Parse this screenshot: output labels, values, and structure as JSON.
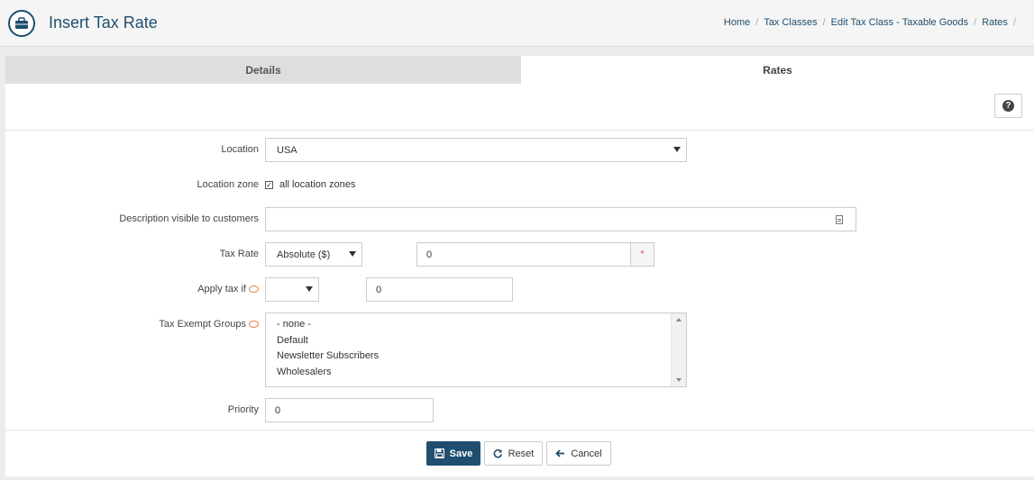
{
  "header": {
    "title": "Insert Tax Rate",
    "icon": "briefcase-icon",
    "breadcrumb": [
      "Home",
      "Tax Classes",
      "Edit Tax Class - Taxable Goods",
      "Rates"
    ]
  },
  "tabs": [
    {
      "label": "Details",
      "active": false
    },
    {
      "label": "Rates",
      "active": true
    }
  ],
  "form": {
    "location": {
      "label": "Location",
      "value": "USA"
    },
    "location_zone": {
      "label": "Location zone",
      "checkbox_label": "all location zones",
      "checked": true
    },
    "description": {
      "label": "Description visible to customers",
      "value": ""
    },
    "tax_rate": {
      "label": "Tax Rate",
      "type_value": "Absolute ($)",
      "amount": "0",
      "required_mark": "*"
    },
    "apply_tax_if": {
      "label": "Apply tax if",
      "condition": "",
      "value": "0"
    },
    "tax_exempt_groups": {
      "label": "Tax Exempt Groups",
      "options": [
        "- none -",
        "Default",
        "Newsletter Subscribers",
        "Wholesalers"
      ]
    },
    "priority": {
      "label": "Priority",
      "value": "0"
    }
  },
  "actions": {
    "save": "Save",
    "reset": "Reset",
    "cancel": "Cancel"
  },
  "colors": {
    "brand": "#1f4e6e",
    "accent_icon": "#e8843a",
    "required": "#ee3333"
  }
}
